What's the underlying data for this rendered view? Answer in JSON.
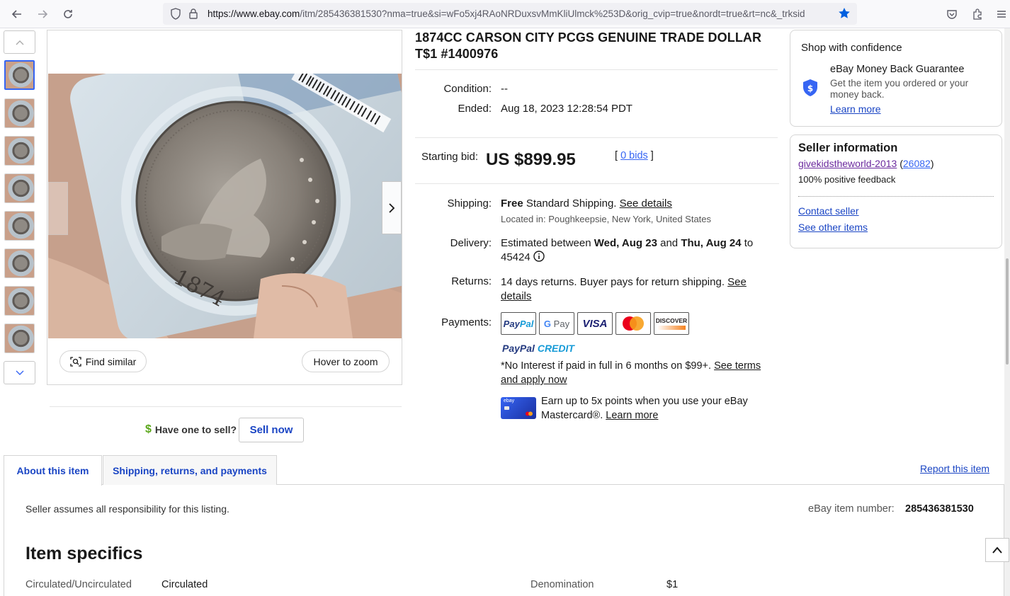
{
  "browser": {
    "url_domain": "https://www.ebay.com",
    "url_path": "/itm/285436381530?nma=true&si=wFo5xj4RAoNRDuxsvMmKliUlmck%253D&orig_cvip=true&nordt=true&rt=nc&_trksid"
  },
  "gallery": {
    "find_similar": "Find similar",
    "hover_zoom": "Hover to zoom",
    "coin_year": "1874",
    "thumb_count": 8
  },
  "sell": {
    "dollar_icon": "$",
    "question": "Have one to sell?",
    "button": "Sell now"
  },
  "item": {
    "title": "1874CC CARSON CITY PCGS GENUINE TRADE DOLLAR T$1 #1400976",
    "condition_label": "Condition:",
    "condition_value": "--",
    "ended_label": "Ended:",
    "ended_value": "Aug 18, 2023 12:28:54 PDT",
    "starting_bid_label": "Starting bid:",
    "price": "US $899.95",
    "bids_open": "[",
    "bids_link": "0 bids",
    "bids_close": "]"
  },
  "shipping": {
    "label": "Shipping:",
    "free": "Free",
    "method": " Standard Shipping. ",
    "see_details": "See details",
    "located": "Located in: Poughkeepsie, New York, United States"
  },
  "delivery": {
    "label": "Delivery:",
    "text1": "Estimated between ",
    "date1": "Wed, Aug 23",
    "and": " and ",
    "date2": "Thu, Aug 24",
    "to": " to",
    "zip": "45424"
  },
  "returns": {
    "label": "Returns:",
    "text": "14 days returns. Buyer pays for return shipping. ",
    "link1": "See",
    "link2": "details"
  },
  "payments": {
    "label": "Payments:",
    "logos": [
      "PayPal",
      "G Pay",
      "VISA",
      "Mastercard",
      "DISCOVER"
    ],
    "paypal_credit_1": "PayPal",
    "paypal_credit_2": "CREDIT",
    "no_interest": "*No Interest if paid in full in 6 months on $99+. ",
    "terms_1": "See terms",
    "terms_2": "and apply now",
    "mastercard_1": "Earn up to 5x points when you use your eBay",
    "mastercard_2": "Mastercard®. ",
    "mastercard_link": "Learn more",
    "card_brand": "ebay"
  },
  "confidence": {
    "heading": "Shop with confidence",
    "guarantee_title": "eBay Money Back Guarantee",
    "guarantee_text": "Get the item you ordered or your money back.",
    "learn_more": "Learn more"
  },
  "seller": {
    "heading": "Seller information",
    "name": "givekidstheworld-2013",
    "score_open": "(",
    "score": "26082",
    "score_close": ")",
    "feedback": "100% positive feedback",
    "contact": "Contact seller",
    "other_items": "See other items"
  },
  "tabs": {
    "about": "About this item",
    "shipping": "Shipping, returns, and payments",
    "report": "Report this item"
  },
  "details": {
    "responsibility": "Seller assumes all responsibility for this listing.",
    "item_number_label": "eBay item number:",
    "item_number": "285436381530",
    "specifics_heading": "Item specifics",
    "spec1_label": "Circulated/Uncirculated",
    "spec1_value": "Circulated",
    "spec2_label": "Denomination",
    "spec2_value": "$1"
  },
  "colors": {
    "ebay_blue": "#3665f3",
    "link_purple": "#6b2a9e",
    "tab_blue": "#1a45c4"
  }
}
